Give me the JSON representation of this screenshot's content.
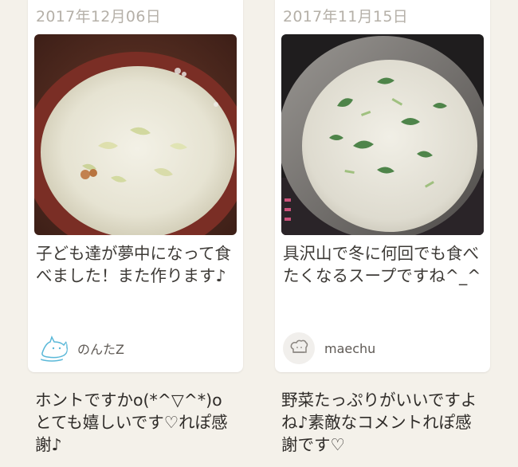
{
  "reviews": [
    {
      "date": "2017年12月06日",
      "comment": "子ども達が夢中になって食べました！また作ります♪",
      "username": "のんたZ",
      "avatar_icon": "cat-sketch-icon",
      "reply": "ホントですかo(*^▽^*)oとても嬉しいです♡れぽ感謝♪"
    },
    {
      "date": "2017年11月15日",
      "comment": "具沢山で冬に何回でも食べたくなるスープですね^_^",
      "username": "maechu",
      "avatar_icon": "chef-hat-icon",
      "reply": "野菜たっぷりがいいですよね♪素敵なコメントれぽ感謝です♡"
    }
  ],
  "colors": {
    "background": "#f4f1ea",
    "card": "#ffffff",
    "date_text": "#b5b0a8",
    "body_text": "#3d3a36"
  }
}
